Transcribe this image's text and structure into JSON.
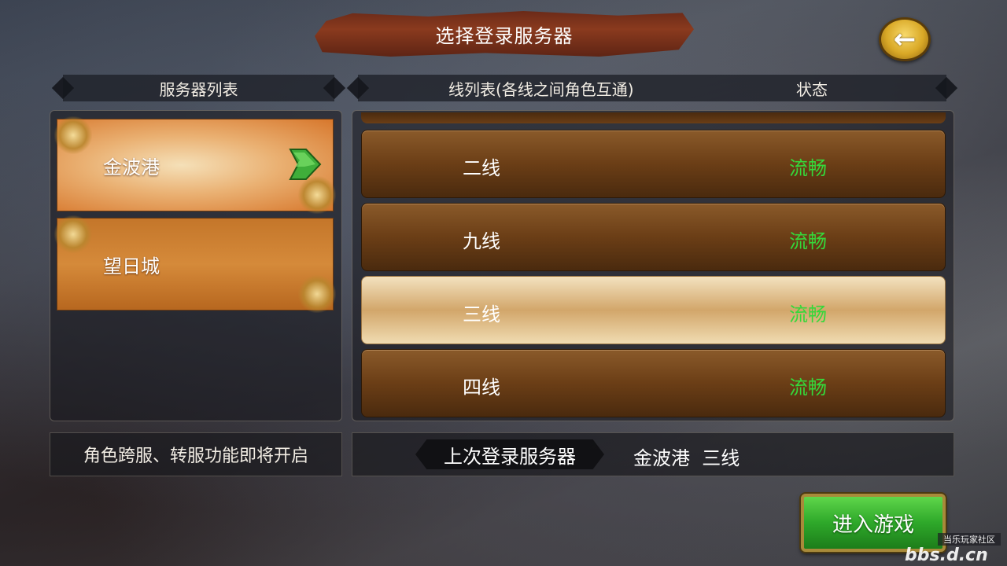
{
  "title": "选择登录服务器",
  "back_button": {
    "icon": "back-arrow-icon",
    "glyph": "←"
  },
  "headers": {
    "server_list": "服务器列表",
    "line_list": "线列表(各线之间角色互通)",
    "status": "状态"
  },
  "servers": [
    {
      "name": "金波港",
      "selected": true
    },
    {
      "name": "望日城",
      "selected": false
    }
  ],
  "lines": [
    {
      "name": "二线",
      "status": "流畅",
      "selected": false
    },
    {
      "name": "九线",
      "status": "流畅",
      "selected": false
    },
    {
      "name": "三线",
      "status": "流畅",
      "selected": true
    },
    {
      "name": "四线",
      "status": "流畅",
      "selected": false
    }
  ],
  "notice": "角色跨服、转服功能即将开启",
  "last_login": {
    "label": "上次登录服务器",
    "server": "金波港",
    "line": "三线"
  },
  "enter_button": "进入游戏",
  "watermark": {
    "top": "当乐玩家社区",
    "main": "bbs.d.cn"
  },
  "colors": {
    "status_green": "#35d83a",
    "enter_green": "#2ea82a",
    "gold": "#d9a826"
  }
}
